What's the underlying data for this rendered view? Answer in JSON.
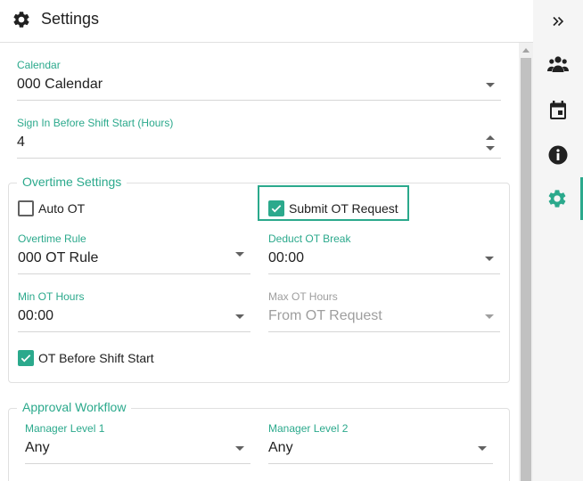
{
  "header": {
    "title": "Settings",
    "icon": "gear-icon"
  },
  "rail": {
    "items": [
      {
        "name": "expand",
        "icon": "chevron-double-right-icon"
      },
      {
        "name": "users",
        "icon": "users-icon"
      },
      {
        "name": "calendar",
        "icon": "calendar-icon"
      },
      {
        "name": "info",
        "icon": "info-icon"
      },
      {
        "name": "settings",
        "icon": "gear-icon",
        "active": true
      }
    ]
  },
  "form": {
    "calendar": {
      "label": "Calendar",
      "value": "000 Calendar"
    },
    "sign_in_before": {
      "label": "Sign In Before Shift Start (Hours)",
      "value": "4"
    },
    "overtime": {
      "legend": "Overtime Settings",
      "auto_ot": {
        "label": "Auto OT",
        "checked": false
      },
      "submit_ot_request": {
        "label": "Submit OT Request",
        "checked": true
      },
      "overtime_rule": {
        "label": "Overtime Rule",
        "value": "000 OT Rule"
      },
      "deduct_ot_break": {
        "label": "Deduct OT Break",
        "value": "00:00"
      },
      "min_ot_hours": {
        "label": "Min OT Hours",
        "value": "00:00"
      },
      "max_ot_hours": {
        "label": "Max OT Hours",
        "value": "From OT Request",
        "disabled": true
      },
      "ot_before_shift_start": {
        "label": "OT Before Shift Start",
        "checked": true
      }
    },
    "approval": {
      "legend": "Approval Workflow",
      "manager_level_1": {
        "label": "Manager Level 1",
        "value": "Any"
      },
      "manager_level_2": {
        "label": "Manager Level 2",
        "value": "Any"
      }
    }
  },
  "colors": {
    "accent": "#2ba98c",
    "text": "#212121",
    "muted": "#9e9e9e",
    "rail_bg": "#f5f5f5"
  }
}
